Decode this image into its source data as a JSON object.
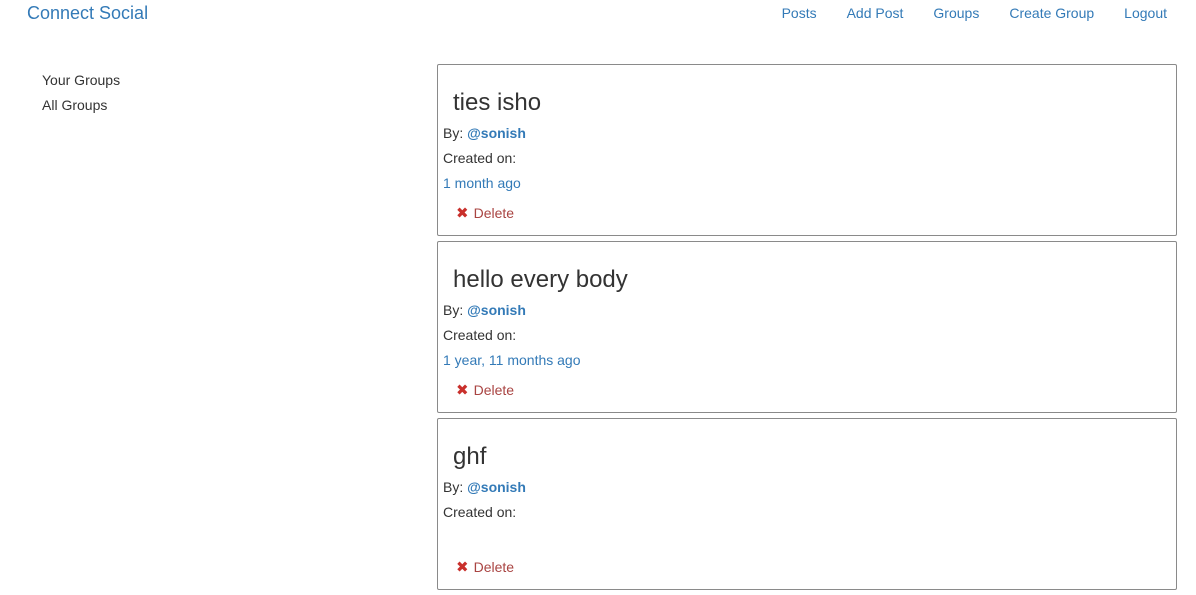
{
  "navbar": {
    "brand": "Connect Social",
    "links": [
      "Posts",
      "Add Post",
      "Groups",
      "Create Group",
      "Logout"
    ]
  },
  "sidebar": {
    "items": [
      "Your Groups",
      "All Groups"
    ]
  },
  "posts": [
    {
      "title": "ties isho",
      "by_label": "By:",
      "author": "@sonish",
      "created_label": "Created on:",
      "time": "1 month ago",
      "delete_label": "Delete"
    },
    {
      "title": "hello every body",
      "by_label": "By:",
      "author": "@sonish",
      "created_label": "Created on:",
      "time": "1 year, 11 months ago",
      "delete_label": "Delete"
    },
    {
      "title": "ghf",
      "by_label": "By:",
      "author": "@sonish",
      "created_label": "Created on:",
      "time": "",
      "delete_label": "Delete"
    }
  ],
  "colors": {
    "link": "#337ab7",
    "text": "#333333",
    "delete": "#a94442",
    "border": "#8a8a8a"
  },
  "icons": {
    "delete": "remove-x-icon"
  }
}
